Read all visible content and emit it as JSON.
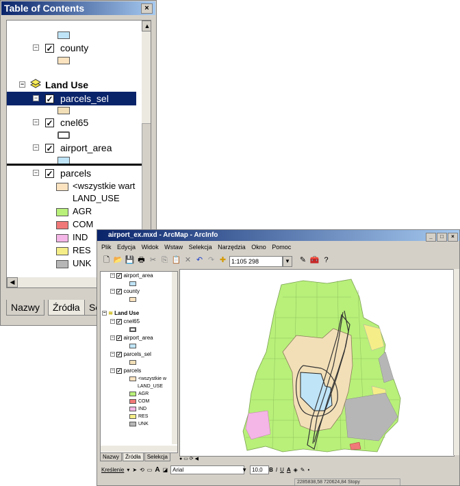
{
  "toc_window": {
    "title": "Table of Contents",
    "close_glyph": "×",
    "layers": [
      {
        "label": "county",
        "checked": true,
        "swatch": "#fbe3c0"
      },
      {
        "label": "Land Use",
        "group": true
      },
      {
        "label": "parcels_sel",
        "checked": true,
        "selected": true,
        "swatch": "#f2dfb8"
      },
      {
        "label": "cnel65",
        "checked": true,
        "swatch": "#ffffff"
      },
      {
        "label": "airport_area",
        "checked": true,
        "swatch": "#bfe4f7"
      },
      {
        "label": "parcels",
        "checked": true
      }
    ],
    "top_swatch": "#bfe4f7",
    "legend": {
      "all_values": "<wszystkie wart",
      "field": "LAND_USE",
      "classes": [
        {
          "label": "AGR",
          "color": "#b8f07a"
        },
        {
          "label": "COM",
          "color": "#f07878"
        },
        {
          "label": "IND",
          "color": "#f4b6e6"
        },
        {
          "label": "RES",
          "color": "#f5ee88"
        },
        {
          "label": "UNK",
          "color": "#b6b6b6"
        }
      ]
    },
    "tabs": [
      "Nazwy",
      "Źródła",
      "Se"
    ]
  },
  "arcmap": {
    "title": "airport_ex.mxd - ArcMap - ArcInfo",
    "menu": [
      "Plik",
      "Edycja",
      "Widok",
      "Wstaw",
      "Selekcja",
      "Narzędzia",
      "Okno",
      "Pomoc"
    ],
    "scale": "1:105 298",
    "mini_toc": {
      "layers_top": [
        {
          "label": "airport_area",
          "swatch": "#bfe4f7"
        },
        {
          "label": "county",
          "swatch": "#fbe3c0"
        }
      ],
      "group": "Land Use",
      "layers": [
        {
          "label": "cnel65",
          "swatch": "#ffffff"
        },
        {
          "label": "airport_area",
          "swatch": "#bfe4f7"
        },
        {
          "label": "parcels_sel",
          "swatch": "#f2dfb8"
        },
        {
          "label": "parcels"
        }
      ],
      "legend_all": "<wszystkie w",
      "legend_field": "LAND_USE",
      "classes": [
        "AGR",
        "COM",
        "IND",
        "RES",
        "UNK"
      ],
      "tabs": [
        "Nazwy",
        "Źródła",
        "Selekcja"
      ]
    },
    "drawing": {
      "label": "Kreślenie",
      "font": "Arial",
      "size": "10,0",
      "bold": "B",
      "italic": "I",
      "underline": "U"
    },
    "status_coords": "2285838,58  720624,84 Stopy"
  }
}
